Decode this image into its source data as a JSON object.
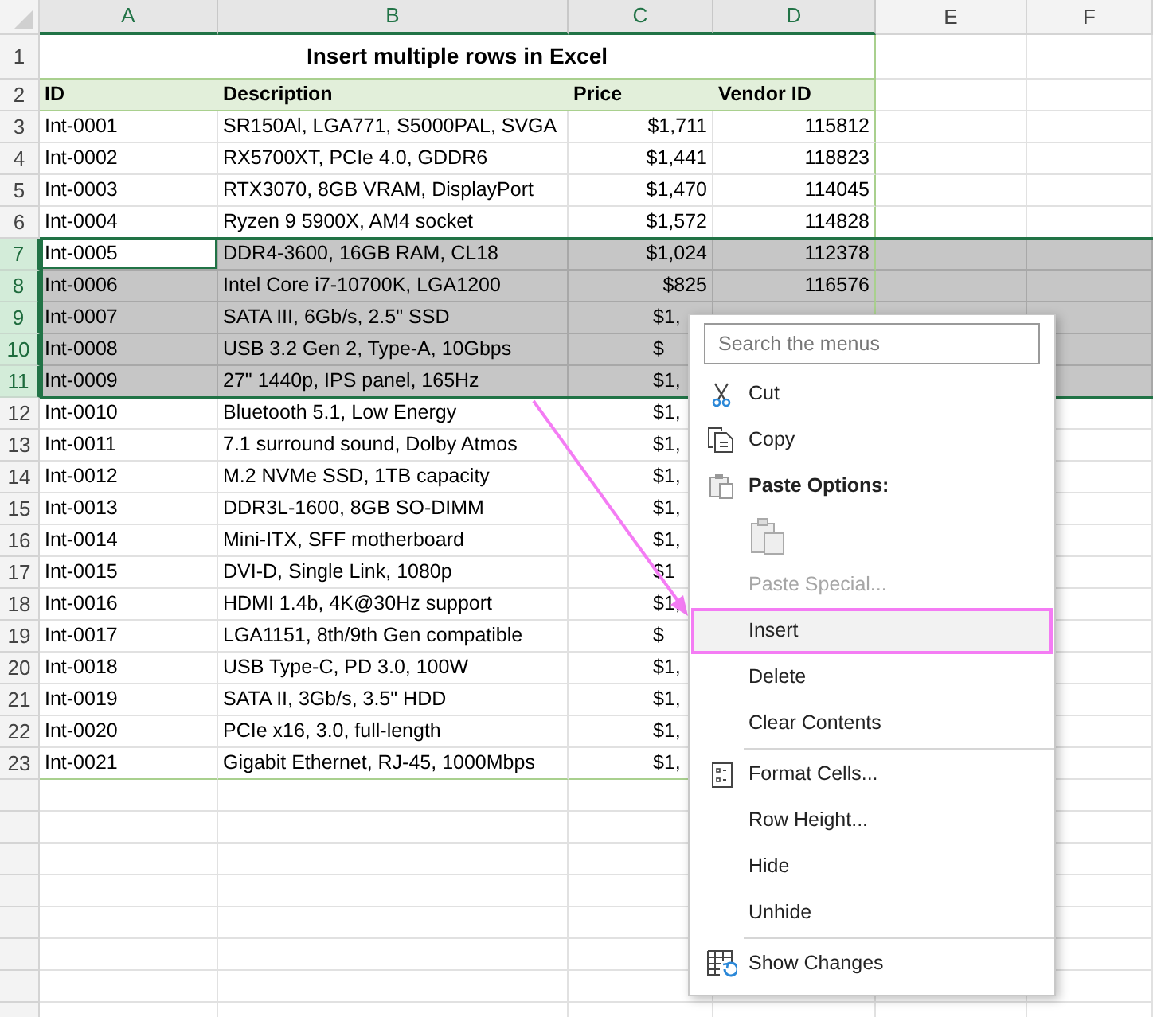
{
  "column_headers": [
    {
      "label": "A",
      "selected": true
    },
    {
      "label": "B",
      "selected": true
    },
    {
      "label": "C",
      "selected": true
    },
    {
      "label": "D",
      "selected": true
    },
    {
      "label": "E",
      "selected": false
    },
    {
      "label": "F",
      "selected": false
    }
  ],
  "title_row": {
    "row_number": "1",
    "text": "Insert multiple rows in Excel"
  },
  "header_row": {
    "row_number": "2",
    "cells": [
      "ID",
      "Description",
      "Price",
      "Vendor ID"
    ]
  },
  "rows": [
    {
      "row_number": "3",
      "id": "Int-0001",
      "description": "SR150Al, LGA771, S5000PAL, SVGA",
      "price": "$1,711",
      "vendor_id": "115812",
      "selected": false,
      "active": false
    },
    {
      "row_number": "4",
      "id": "Int-0002",
      "description": "RX5700XT, PCIe 4.0, GDDR6",
      "price": "$1,441",
      "vendor_id": "118823",
      "selected": false,
      "active": false
    },
    {
      "row_number": "5",
      "id": "Int-0003",
      "description": "RTX3070, 8GB VRAM, DisplayPort",
      "price": "$1,470",
      "vendor_id": "114045",
      "selected": false,
      "active": false
    },
    {
      "row_number": "6",
      "id": "Int-0004",
      "description": "Ryzen 9 5900X, AM4 socket",
      "price": "$1,572",
      "vendor_id": "114828",
      "selected": false,
      "active": false
    },
    {
      "row_number": "7",
      "id": "Int-0005",
      "description": "DDR4-3600, 16GB RAM, CL18",
      "price": "$1,024",
      "vendor_id": "112378",
      "selected": true,
      "active": true
    },
    {
      "row_number": "8",
      "id": "Int-0006",
      "description": "Intel Core i7-10700K, LGA1200",
      "price": "$825",
      "vendor_id": "116576",
      "selected": true,
      "active": false
    },
    {
      "row_number": "9",
      "id": "Int-0007",
      "description": "SATA III, 6Gb/s, 2.5\" SSD",
      "price": "$1,",
      "selected": true,
      "active": false
    },
    {
      "row_number": "10",
      "id": "Int-0008",
      "description": "USB 3.2 Gen 2, Type-A, 10Gbps",
      "price": "$",
      "selected": true,
      "active": false
    },
    {
      "row_number": "11",
      "id": "Int-0009",
      "description": "27\" 1440p, IPS panel, 165Hz",
      "price": "$1,",
      "selected": true,
      "active": false
    },
    {
      "row_number": "12",
      "id": "Int-0010",
      "description": "Bluetooth 5.1, Low Energy",
      "price": "$1,",
      "selected": false,
      "active": false
    },
    {
      "row_number": "13",
      "id": "Int-0011",
      "description": "7.1 surround sound, Dolby Atmos",
      "price": "$1,",
      "selected": false,
      "active": false
    },
    {
      "row_number": "14",
      "id": "Int-0012",
      "description": "M.2 NVMe SSD, 1TB capacity",
      "price": "$1,",
      "selected": false,
      "active": false
    },
    {
      "row_number": "15",
      "id": "Int-0013",
      "description": "DDR3L-1600, 8GB SO-DIMM",
      "price": "$1,",
      "selected": false,
      "active": false
    },
    {
      "row_number": "16",
      "id": "Int-0014",
      "description": "Mini-ITX, SFF motherboard",
      "price": "$1,",
      "selected": false,
      "active": false
    },
    {
      "row_number": "17",
      "id": "Int-0015",
      "description": "DVI-D, Single Link, 1080p",
      "price": "$1",
      "selected": false,
      "active": false
    },
    {
      "row_number": "18",
      "id": "Int-0016",
      "description": "HDMI 1.4b, 4K@30Hz support",
      "price": "$1,",
      "selected": false,
      "active": false
    },
    {
      "row_number": "19",
      "id": "Int-0017",
      "description": "LGA1151, 8th/9th Gen compatible",
      "price": "$",
      "selected": false,
      "active": false
    },
    {
      "row_number": "20",
      "id": "Int-0018",
      "description": "USB Type-C, PD 3.0, 100W",
      "price": "$1,",
      "selected": false,
      "active": false
    },
    {
      "row_number": "21",
      "id": "Int-0019",
      "description": "SATA II, 3Gb/s, 3.5\" HDD",
      "price": "$1,",
      "selected": false,
      "active": false
    },
    {
      "row_number": "22",
      "id": "Int-0020",
      "description": "PCIe x16, 3.0, full-length",
      "price": "$1,",
      "selected": false,
      "active": false
    },
    {
      "row_number": "23",
      "id": "Int-0021",
      "description": "Gigabit Ethernet, RJ-45, 1000Mbps",
      "price": "$1,",
      "selected": false,
      "active": false
    }
  ],
  "context_menu": {
    "search": {
      "placeholder": "Search the menus"
    },
    "items": [
      {
        "kind": "command",
        "label": "Cut",
        "disabled": false,
        "selected": false
      },
      {
        "kind": "command",
        "label": "Copy",
        "disabled": false,
        "selected": false
      },
      {
        "kind": "heading",
        "label": "Paste Options:"
      },
      {
        "kind": "paste_option"
      },
      {
        "kind": "command",
        "label": "Paste Special...",
        "disabled": true,
        "selected": false
      },
      {
        "kind": "command",
        "label": "Insert",
        "disabled": false,
        "selected": true
      },
      {
        "kind": "command",
        "label": "Delete",
        "disabled": false,
        "selected": false
      },
      {
        "kind": "command",
        "label": "Clear Contents",
        "disabled": false,
        "selected": false
      },
      {
        "kind": "separator"
      },
      {
        "kind": "command",
        "label": "Format Cells...",
        "disabled": false,
        "selected": false
      },
      {
        "kind": "command",
        "label": "Row Height...",
        "disabled": false,
        "selected": false
      },
      {
        "kind": "command",
        "label": "Hide",
        "disabled": false,
        "selected": false
      },
      {
        "kind": "command",
        "label": "Unhide",
        "disabled": false,
        "selected": false
      },
      {
        "kind": "separator"
      },
      {
        "kind": "command",
        "label": "Show Changes",
        "disabled": false,
        "selected": false
      }
    ]
  }
}
